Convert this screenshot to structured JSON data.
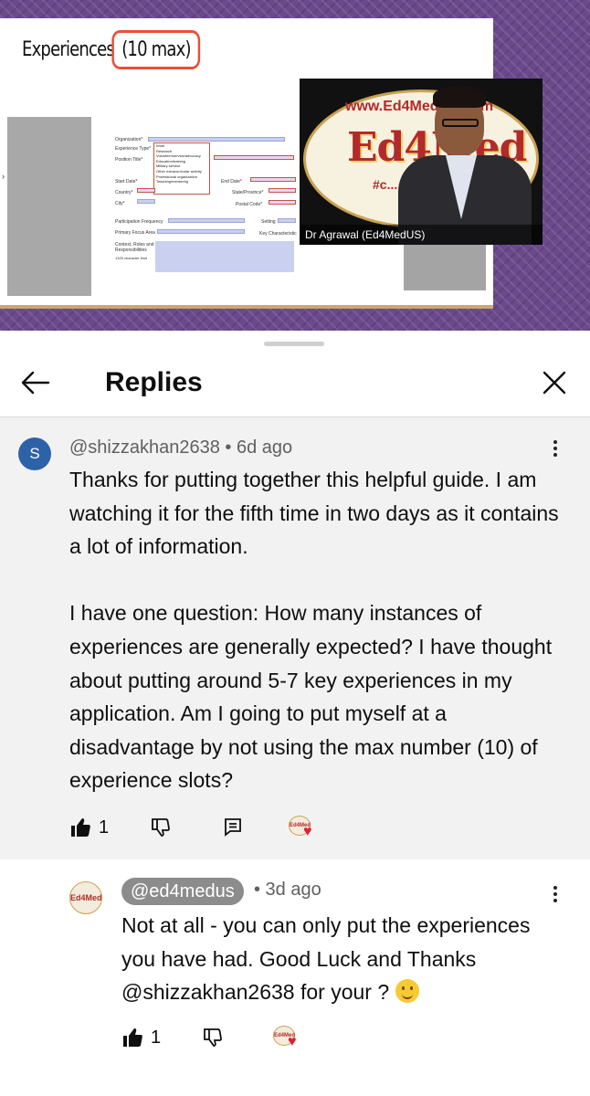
{
  "video": {
    "slide_title": "Experiences ",
    "slide_title_highlight": "(10 max)",
    "form": {
      "labels": {
        "organization": "Organization*",
        "experience_type": "Experience Type*",
        "position_title": "Position Title*",
        "start_date": "Start Date*",
        "end_date": "End Date*",
        "country": "Country*",
        "state": "State/Province*",
        "city": "City*",
        "postal": "Postal Code*",
        "participation": "Participation Frequency",
        "setting": "Setting",
        "focus": "Primary Focus Area",
        "key_char": "Key Characteristic",
        "context": "Context, Roles and Responsibilities",
        "char_limit": "1325 character limit"
      },
      "dropdown_options": [
        "Work",
        "Research",
        "Volunteer/service/advocacy",
        "Education/training",
        "Military service",
        "Other extracurricular activity",
        "Professional organization",
        "Teaching/mentoring"
      ]
    },
    "webcam": {
      "logo_url": "www.Ed4MedUS.com",
      "logo_text": "Ed4Med",
      "logo_sub": "#c... w...",
      "caption": "Dr Agrawal (Ed4MedUS)"
    }
  },
  "sheet": {
    "title": "Replies"
  },
  "comment": {
    "avatar_letter": "S",
    "author": "@shizzakhan2638",
    "separator": " • ",
    "age": "6d ago",
    "text": "Thanks for putting together this helpful guide. I am watching it for the fifth time in two days as it contains a lot of information.\n\nI have one question: How many instances of experiences are generally expected? I have thought about putting around 5-7 key experiences in my application. Am I going to put myself at a disadvantage by not using the max number (10) of experience slots?",
    "likes": "1"
  },
  "reply": {
    "avatar_text": "Ed4Med",
    "author": "@ed4medus",
    "meta": "• 3d ago",
    "text": "Not at all - you can only put the experiences you have had. Good Luck and Thanks @shizzakhan2638 for your ? ",
    "likes": "1"
  },
  "creator_heart_logo": "Ed4Med",
  "colors": {
    "avatar_blue": "#2e62a8",
    "heart_red": "#e0202f",
    "comment_bg": "#f2f2f2",
    "badge_gray": "#8c8c8c"
  },
  "icons": [
    "back-arrow-icon",
    "close-icon",
    "more-vert-icon",
    "thumbs-up-icon",
    "thumbs-down-icon",
    "reply-icon",
    "creator-heart-icon"
  ]
}
